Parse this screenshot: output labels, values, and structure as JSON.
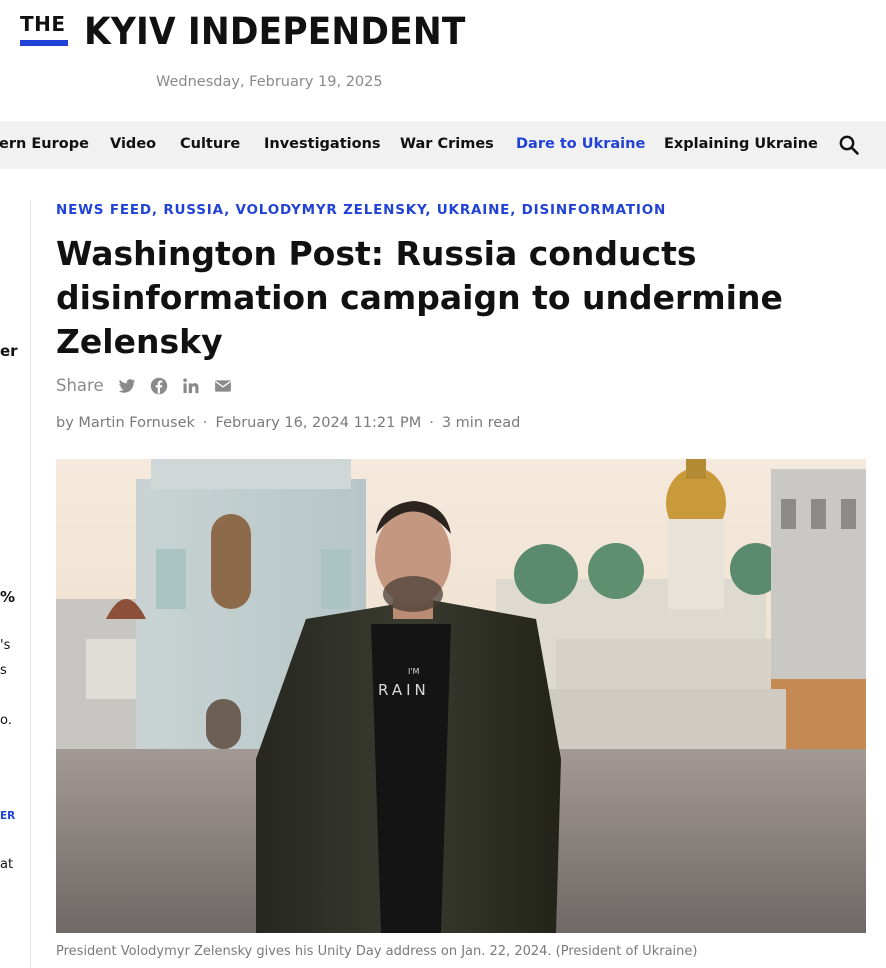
{
  "header": {
    "logo_the": "THE",
    "logo_name": "KYIV INDEPENDENT",
    "date": "Wednesday, February 19, 2025"
  },
  "nav": {
    "items": [
      {
        "label": "ern Europe",
        "active": false
      },
      {
        "label": "Video",
        "active": false
      },
      {
        "label": "Culture",
        "active": false
      },
      {
        "label": "Investigations",
        "active": false
      },
      {
        "label": "War Crimes",
        "active": false
      },
      {
        "label": "Dare to Ukraine",
        "active": true
      },
      {
        "label": "Explaining Ukraine",
        "active": false
      }
    ],
    "search_icon": "search-icon"
  },
  "sidebar": {
    "fragments": [
      "er",
      "%",
      "'s",
      "s",
      "o.",
      "ER",
      "at"
    ]
  },
  "article": {
    "tags": [
      "NEWS FEED",
      "RUSSIA",
      "VOLODYMYR ZELENSKY",
      "UKRAINE",
      "DISINFORMATION"
    ],
    "title": "Washington Post: Russia conducts disinformation campaign to undermine Zelensky",
    "share_label": "Share",
    "share_icons": [
      "twitter-icon",
      "facebook-icon",
      "linkedin-icon",
      "email-icon"
    ],
    "author": "by Martin Fornusek",
    "published": "February 16, 2024 11:21 PM",
    "read_time": "3 min read",
    "image_text": "I'M RAIN",
    "caption": "President Volodymyr Zelensky gives his Unity Day address on Jan. 22, 2024. (President of Ukraine)"
  },
  "colors": {
    "accent": "#2142d6",
    "nav_bg": "#f1f1f1",
    "muted_text": "#8a8a8a"
  }
}
